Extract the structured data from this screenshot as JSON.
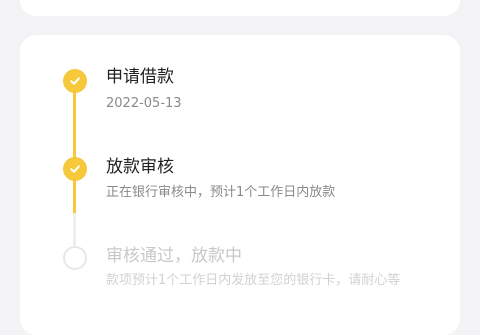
{
  "steps": [
    {
      "title": "申请借款",
      "desc": "2022-05-13",
      "status": "done",
      "icon": "check-icon"
    },
    {
      "title": "放款审核",
      "desc": "正在银行审核中，预计1个工作日内放款",
      "status": "done",
      "icon": "check-icon"
    },
    {
      "title": "审核通过，放款中",
      "desc": "款项预计1个工作日内发放至您的银行卡，请耐心等",
      "status": "pending",
      "icon": "empty-circle-icon"
    }
  ],
  "colors": {
    "accent": "#f6c93a",
    "background": "#f3f3f5",
    "card": "#ffffff"
  }
}
